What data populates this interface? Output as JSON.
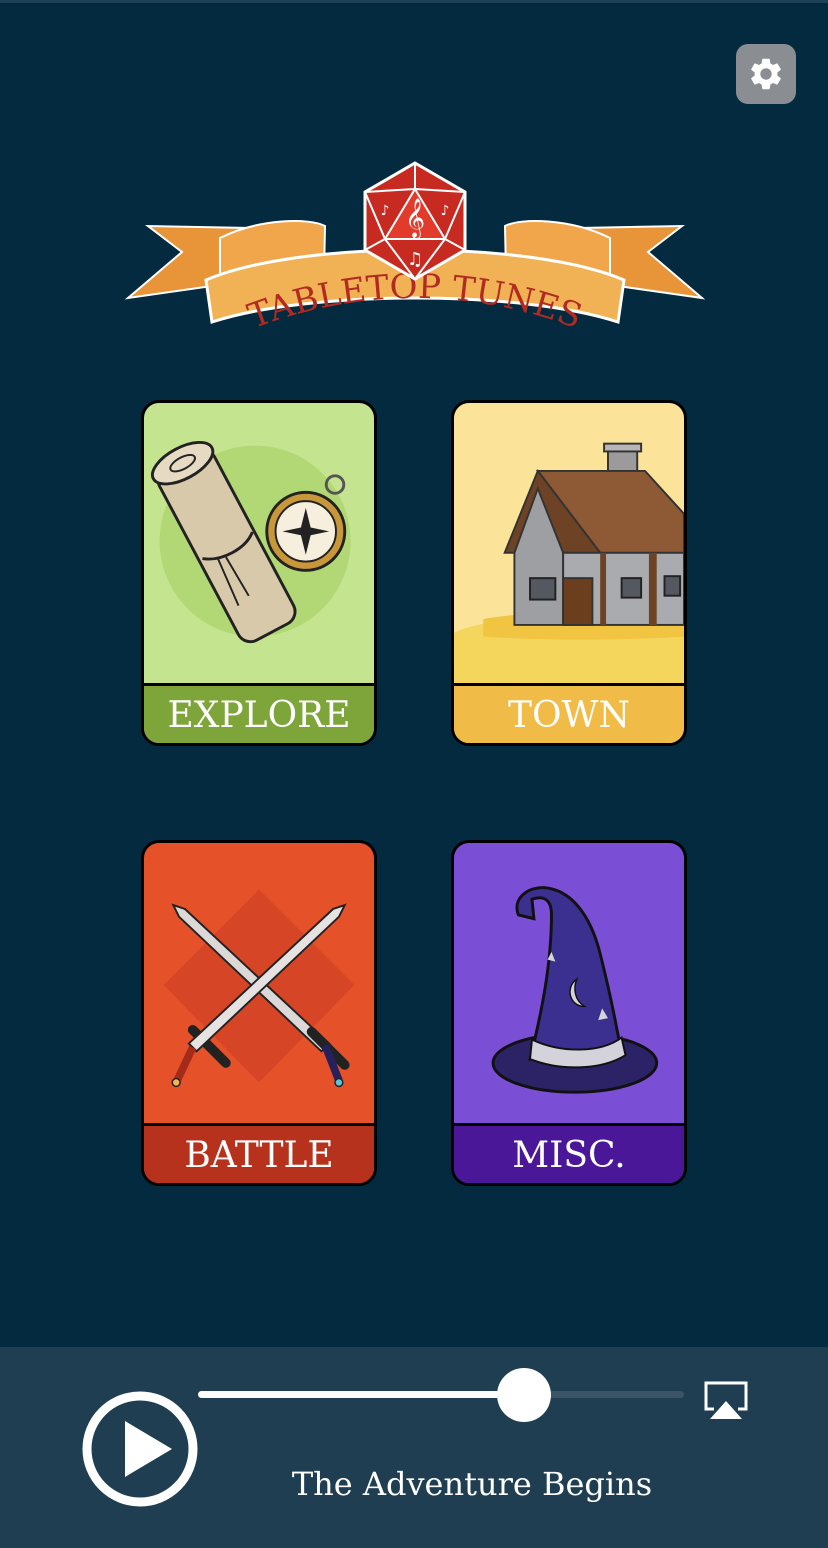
{
  "app": {
    "title": "TABLETOP TUNES",
    "background_color": "#032a3e"
  },
  "settings": {
    "icon": "gear-icon"
  },
  "categories": [
    {
      "label": "EXPLORE",
      "icon": "map-compass-icon",
      "color": "#c5e48f",
      "label_color": "#7ea53a"
    },
    {
      "label": "TOWN",
      "icon": "house-icon",
      "color": "#fbe39a",
      "label_color": "#f1bb47"
    },
    {
      "label": "BATTLE",
      "icon": "crossed-swords-icon",
      "color": "#e5522a",
      "label_color": "#b7321d"
    },
    {
      "label": "MISC.",
      "icon": "wizard-hat-icon",
      "color": "#7b4ed6",
      "label_color": "#4a1799"
    }
  ],
  "player": {
    "track_title": "The Adventure Begins",
    "progress": 0.67,
    "play_icon": "play-icon",
    "airplay_icon": "airplay-icon"
  }
}
